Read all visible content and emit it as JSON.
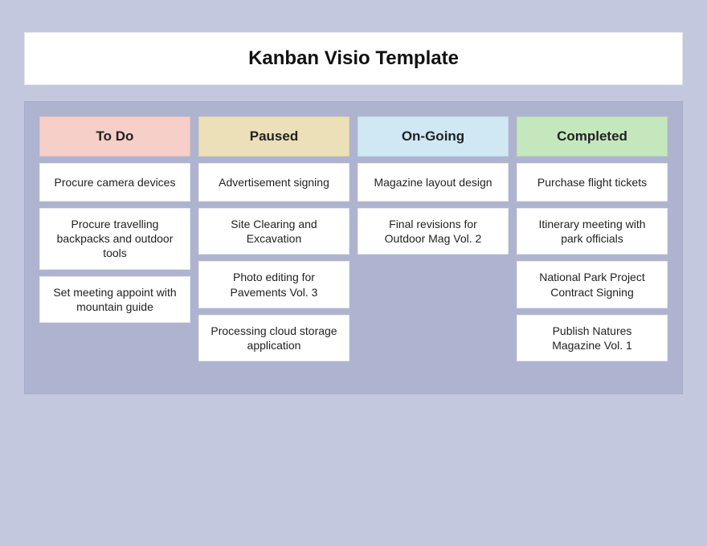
{
  "title": "Kanban Visio Template",
  "columns": [
    {
      "id": "todo",
      "label": "To Do",
      "cards": [
        "Procure camera devices",
        "Procure travelling backpacks and outdoor tools",
        "Set meeting appoint with mountain guide"
      ]
    },
    {
      "id": "paused",
      "label": "Paused",
      "cards": [
        "Advertisement signing",
        "Site Clearing and Excavation",
        "Photo editing for Pavements Vol. 3",
        "Processing cloud storage application"
      ]
    },
    {
      "id": "ongoing",
      "label": "On-Going",
      "cards": [
        "Magazine layout design",
        "Final revisions for Outdoor Mag Vol. 2"
      ]
    },
    {
      "id": "completed",
      "label": "Completed",
      "cards": [
        "Purchase flight tickets",
        "Itinerary meeting with park officials",
        "National Park Project Contract Signing",
        "Publish Natures Magazine Vol. 1"
      ]
    }
  ]
}
